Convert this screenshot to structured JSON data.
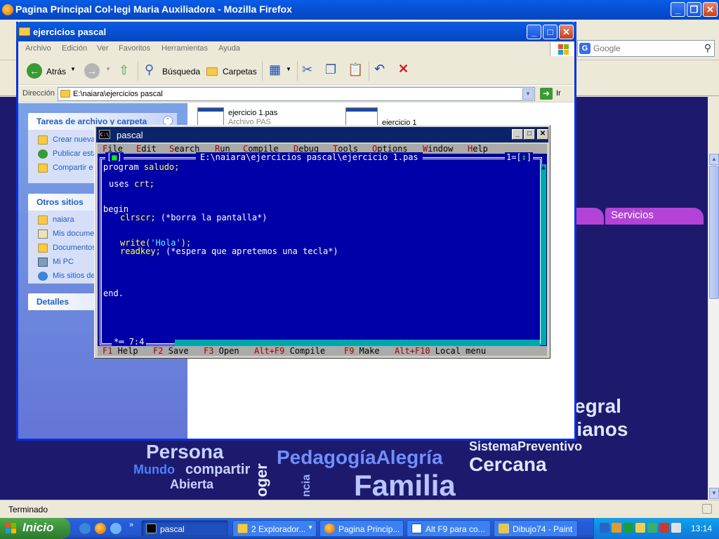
{
  "firefox": {
    "title": "Pagina Principal Col·legi Maria Auxiliadora - Mozilla Firefox",
    "search_placeholder": "Google",
    "status": "Terminado",
    "site_tab": "Servicios",
    "word_cloud": [
      "egral",
      "tianos",
      "SistemaPreventivo",
      "Persona",
      "Mundo",
      "compartir",
      "Abierta",
      "PedagogíaAlegría",
      "Cercana",
      "Familia",
      "oger",
      "ncia"
    ]
  },
  "explorer": {
    "title": "ejercicios pascal",
    "menu": [
      "Archivo",
      "Edición",
      "Ver",
      "Favoritos",
      "Herramientas",
      "Ayuda"
    ],
    "toolbar": {
      "back": "Atrás",
      "search": "Búsqueda",
      "folders": "Carpetas"
    },
    "address_label": "Dirección",
    "address": "E:\\naiara\\ejercicios pascal",
    "go": "Ir",
    "tasks_title": "Tareas de archivo y carpeta",
    "tasks": [
      "Crear nueva",
      "Publicar esta",
      "Compartir e"
    ],
    "places_title": "Otros sitios",
    "places": [
      "naiara",
      "Mis documer",
      "Documentos",
      "Mi PC",
      "Mis sitios de"
    ],
    "details_title": "Detalles",
    "files": [
      {
        "name": "ejercicio 1.pas",
        "type": "Archivo PAS"
      },
      {
        "name": "ejercicio 1"
      }
    ]
  },
  "pascal": {
    "title": "pascal",
    "menu": [
      {
        "hot": "F",
        "rest": "ile"
      },
      {
        "hot": "E",
        "rest": "dit"
      },
      {
        "hot": "S",
        "rest": "earch"
      },
      {
        "hot": "R",
        "rest": "un"
      },
      {
        "hot": "C",
        "rest": "ompile"
      },
      {
        "hot": "D",
        "rest": "ebug"
      },
      {
        "hot": "T",
        "rest": "ools"
      },
      {
        "hot": "O",
        "rest": "ptions"
      },
      {
        "hot": "W",
        "rest": "indow"
      },
      {
        "hot": "H",
        "rest": "elp"
      }
    ],
    "file_path": "E:\\naiara\\ejercicios pascal\\ejercicio 1.pas",
    "window_number": "1",
    "cursor": "7:4",
    "code": {
      "l1_kw": "program",
      "l1_rest": " saludo;",
      "l2_kw": "uses",
      "l2_rest": " crt;",
      "l3": "begin",
      "l4_call": "clrscr;",
      "l4_comment": " (*borra la pantalla*)",
      "l5_call": "write(",
      "l5_str": "'Hola'",
      "l5_end": ");",
      "l6_call": "readkey;",
      "l6_comment": " (*espera que apretemos una tecla*)",
      "l7": "end."
    },
    "status_keys": [
      {
        "key": "F1",
        "label": " Help"
      },
      {
        "key": "F2",
        "label": " Save"
      },
      {
        "key": "F3",
        "label": " Open"
      },
      {
        "key": "Alt+F9",
        "label": " Compile"
      },
      {
        "key": "F9",
        "label": " Make"
      },
      {
        "key": "Alt+F10",
        "label": " Local menu"
      }
    ]
  },
  "taskbar": {
    "start": "Inicio",
    "tasks": [
      "pascal",
      "2 Explorador...",
      "Pagina Princip...",
      "Alt F9 para co...",
      "Dibujo74 - Paint"
    ],
    "clock": "13:14"
  }
}
